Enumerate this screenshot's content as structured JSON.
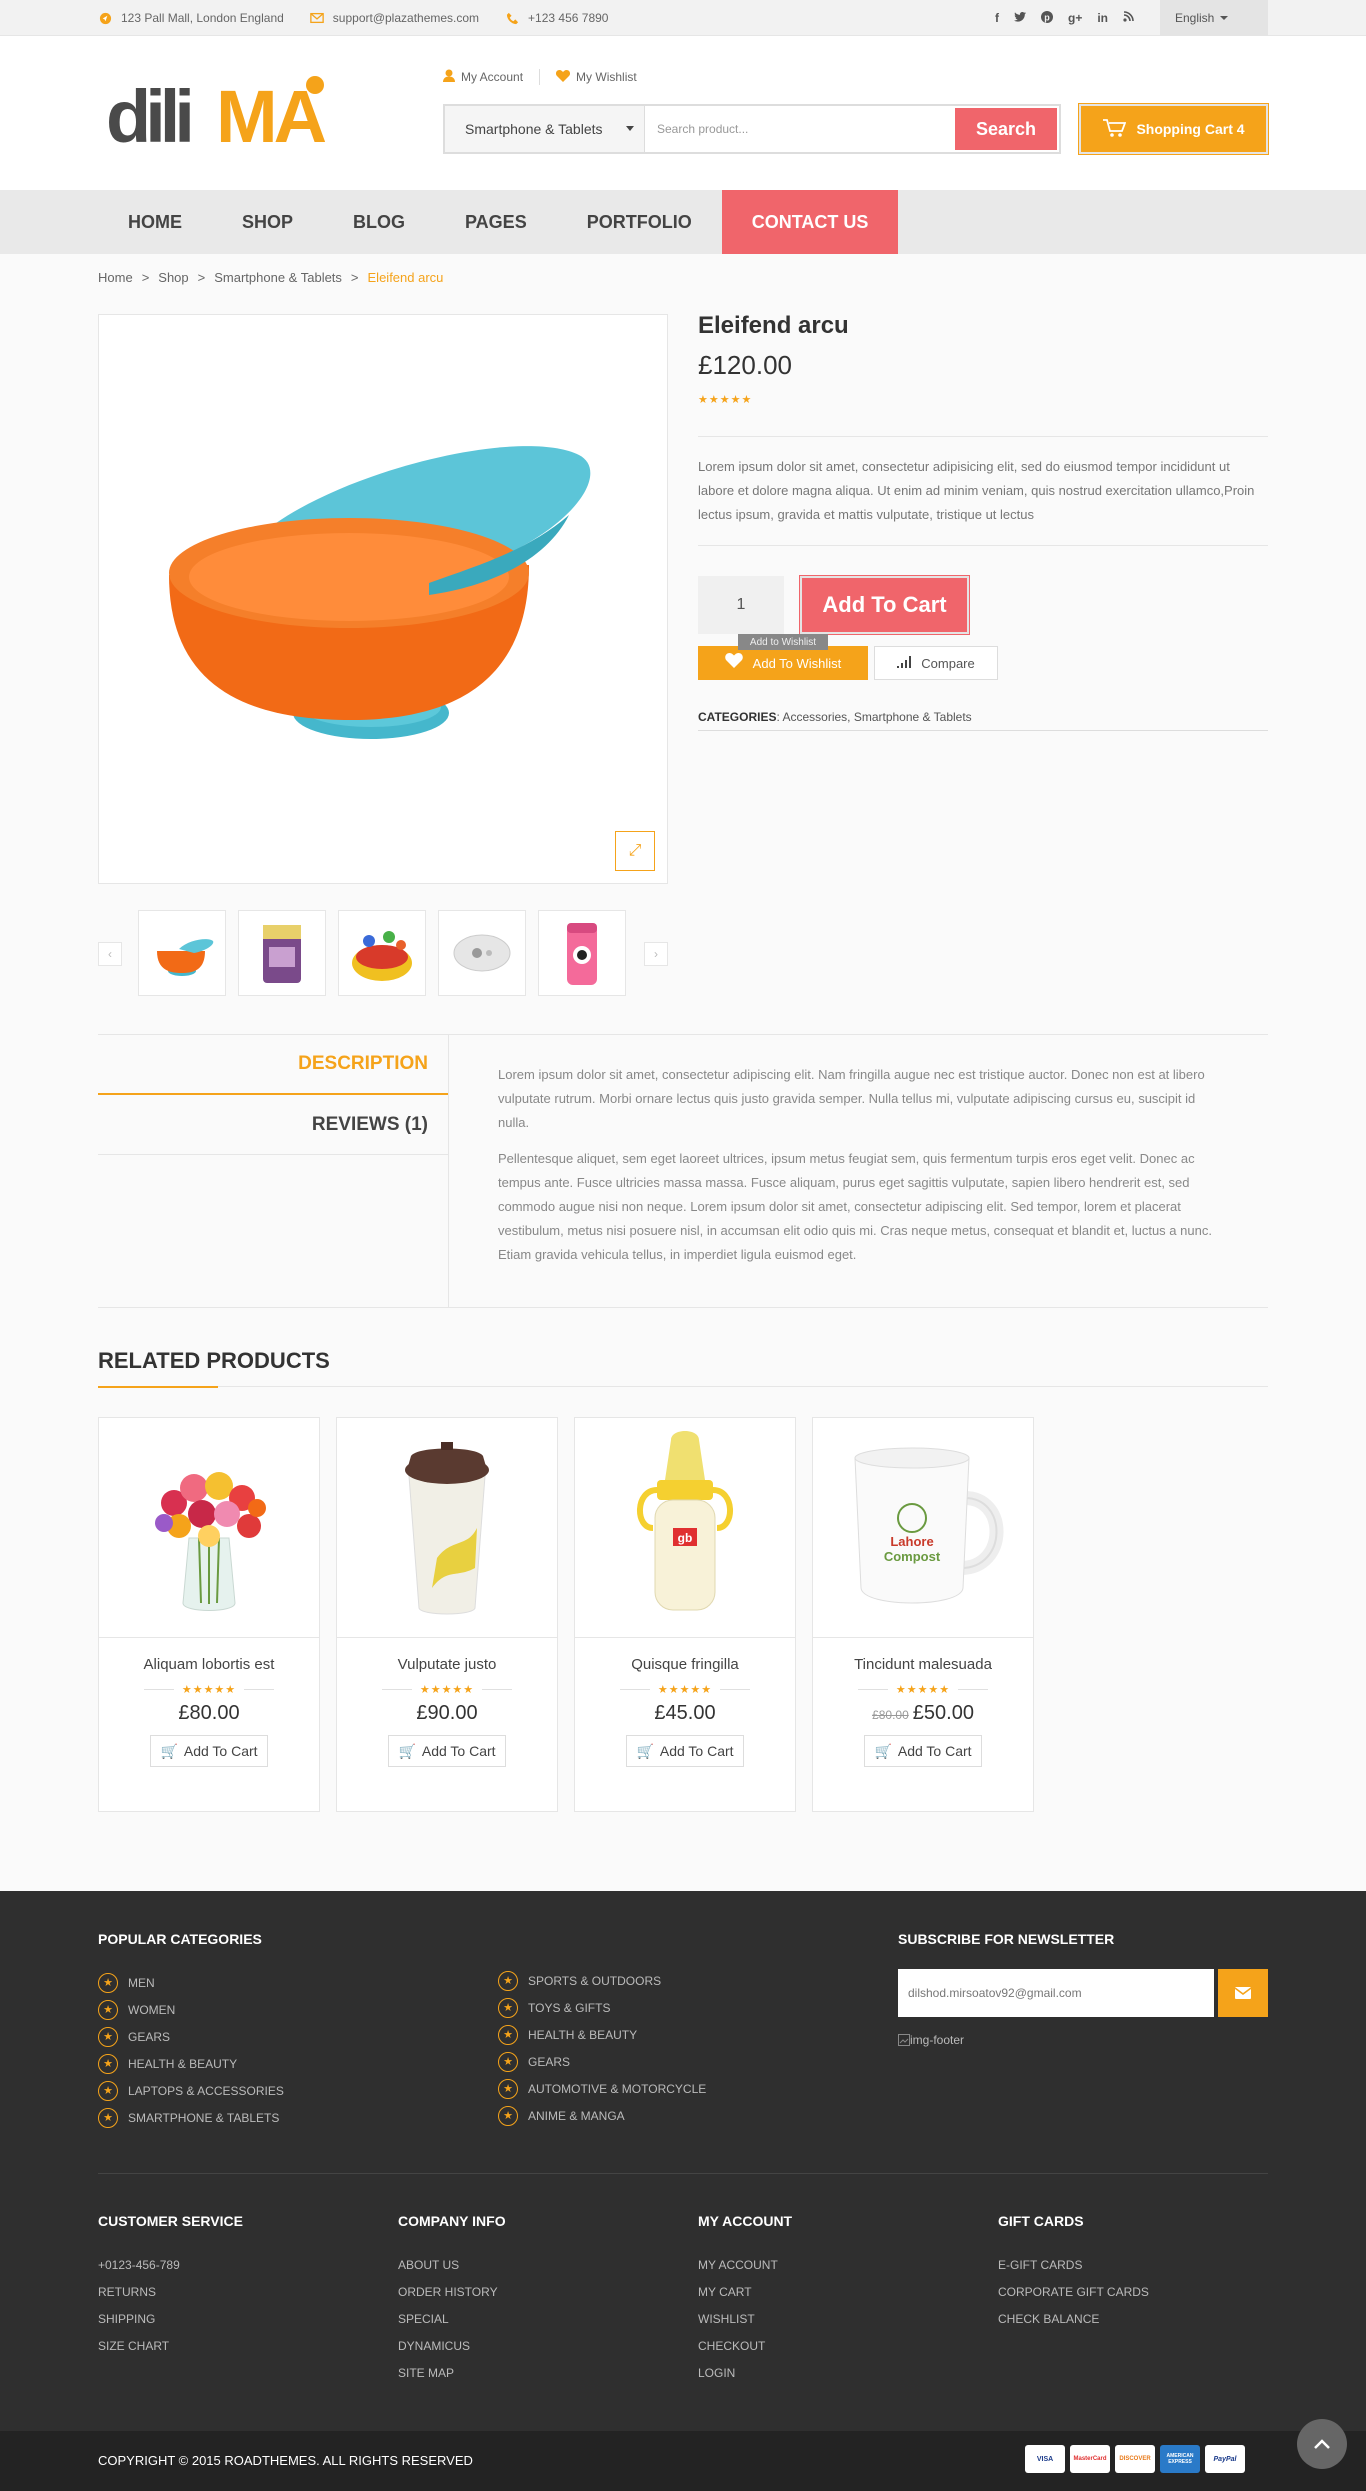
{
  "topbar": {
    "address": "123 Pall Mall, London England",
    "email": "support@plazathemes.com",
    "phone": "+123 456 7890",
    "social_icons": [
      "facebook-icon",
      "twitter-icon",
      "pinterest-icon",
      "google-plus-icon",
      "linkedin-icon",
      "rss-icon"
    ],
    "language": "English"
  },
  "header": {
    "logo_text": "diliMA",
    "account_label": "My Account",
    "wishlist_label": "My Wishlist",
    "category_select": "Smartphone & Tablets",
    "search_placeholder": "Search product...",
    "search_button": "Search",
    "cart_label": "Shopping Cart 4"
  },
  "nav": [
    {
      "label": "HOME"
    },
    {
      "label": "SHOP"
    },
    {
      "label": "BLOG"
    },
    {
      "label": "PAGES"
    },
    {
      "label": "PORTFOLIO"
    },
    {
      "label": "CONTACT US"
    }
  ],
  "breadcrumb": {
    "items": [
      "Home",
      "Shop",
      "Smartphone & Tablets"
    ],
    "separator": ">",
    "current": "Eleifend arcu"
  },
  "product": {
    "title": "Eleifend arcu",
    "price": "£120.00",
    "rating": "★★★★★",
    "description": "Lorem ipsum dolor sit amet, consectetur adipisicing elit, sed do eiusmod tempor incididunt ut labore et dolore magna aliqua. Ut enim ad minim veniam, quis nostrud exercitation ullamco,Proin lectus ipsum, gravida et mattis vulputate, tristique ut lectus",
    "quantity": "1",
    "add_to_cart": "Add To Cart",
    "tooltip": "Add to Wishlist",
    "add_to_wishlist": "Add To Wishlist",
    "compare": "Compare",
    "categories_label": "CATEGORIES",
    "categories": [
      "Accessories",
      "Smartphone & Tablets"
    ]
  },
  "tabs": {
    "description_label": "DESCRIPTION",
    "reviews_label": "REVIEWS (1)",
    "paragraphs": [
      "Lorem ipsum dolor sit amet, consectetur adipiscing elit. Nam fringilla augue nec est tristique auctor. Donec non est at libero vulputate rutrum. Morbi ornare lectus quis justo gravida semper. Nulla tellus mi, vulputate adipiscing cursus eu, suscipit id nulla.",
      "Pellentesque aliquet, sem eget laoreet ultrices, ipsum metus feugiat sem, quis fermentum turpis eros eget velit. Donec ac tempus ante. Fusce ultricies massa massa. Fusce aliquam, purus eget sagittis vulputate, sapien libero hendrerit est, sed commodo augue nisi non neque. Lorem ipsum dolor sit amet, consectetur adipiscing elit. Sed tempor, lorem et placerat vestibulum, metus nisi posuere nisl, in accumsan elit odio quis mi. Cras neque metus, consequat et blandit et, luctus a nunc. Etiam gravida vehicula tellus, in imperdiet ligula euismod eget."
    ]
  },
  "related": {
    "title": "RELATED PRODUCTS",
    "items": [
      {
        "name": "Aliquam lobortis est",
        "rating": "★★★★★",
        "price": "£80.00",
        "old_price": "",
        "button": "Add To Cart"
      },
      {
        "name": "Vulputate justo",
        "rating": "★★★★★",
        "price": "£90.00",
        "old_price": "",
        "button": "Add To Cart"
      },
      {
        "name": "Quisque fringilla",
        "rating": "★★★★★",
        "price": "£45.00",
        "old_price": "",
        "button": "Add To Cart"
      },
      {
        "name": "Tincidunt malesuada",
        "rating": "★★★★★",
        "price": "£50.00",
        "old_price": "£80.00",
        "button": "Add To Cart"
      }
    ],
    "mug_text_1": "Lahore",
    "mug_text_2": "Compost",
    "bottle_badge": "gb"
  },
  "footer": {
    "popular_title": "POPULAR CATEGORIES",
    "popular_col1": [
      "MEN",
      "WOMEN",
      "GEARS",
      "HEALTH & BEAUTY",
      "LAPTOPS & ACCESSORIES",
      "SMARTPHONE & TABLETS"
    ],
    "popular_col2": [
      "SPORTS & OUTDOORS",
      "TOYS & GIFTS",
      "HEALTH & BEAUTY",
      "GEARS",
      "AUTOMOTIVE & MOTORCYCLE",
      "ANIME & MANGA"
    ],
    "newsletter_title": "SUBSCRIBE FOR NEWSLETTER",
    "newsletter_value": "dilshod.mirsoatov92@gmail.com",
    "img_alt": "img-footer",
    "cols": [
      {
        "title": "CUSTOMER SERVICE",
        "items": [
          "+0123-456-789",
          "RETURNS",
          "SHIPPING",
          "SIZE CHART"
        ]
      },
      {
        "title": "COMPANY INFO",
        "items": [
          "ABOUT US",
          "ORDER HISTORY",
          "SPECIAL",
          "DYNAMICUS",
          "SITE MAP"
        ]
      },
      {
        "title": "MY ACCOUNT",
        "items": [
          "MY ACCOUNT",
          "MY CART",
          "WISHLIST",
          "CHECKOUT",
          "LOGIN"
        ]
      },
      {
        "title": "GIFT CARDS",
        "items": [
          "E-GIFT CARDS",
          "CORPORATE GIFT CARDS",
          "CHECK BALANCE"
        ]
      }
    ],
    "copyright": "COPYRIGHT © 2015 ROADTHEMES. ALL RIGHTS RESERVED",
    "payments": [
      "VISA",
      "MasterCard",
      "DISCOVER",
      "AMERICAN EXPRESS",
      "PayPal"
    ]
  },
  "colors": {
    "accent": "#f5a31a",
    "primary": "#f0656b",
    "footer_bg": "#2f2f2f"
  }
}
